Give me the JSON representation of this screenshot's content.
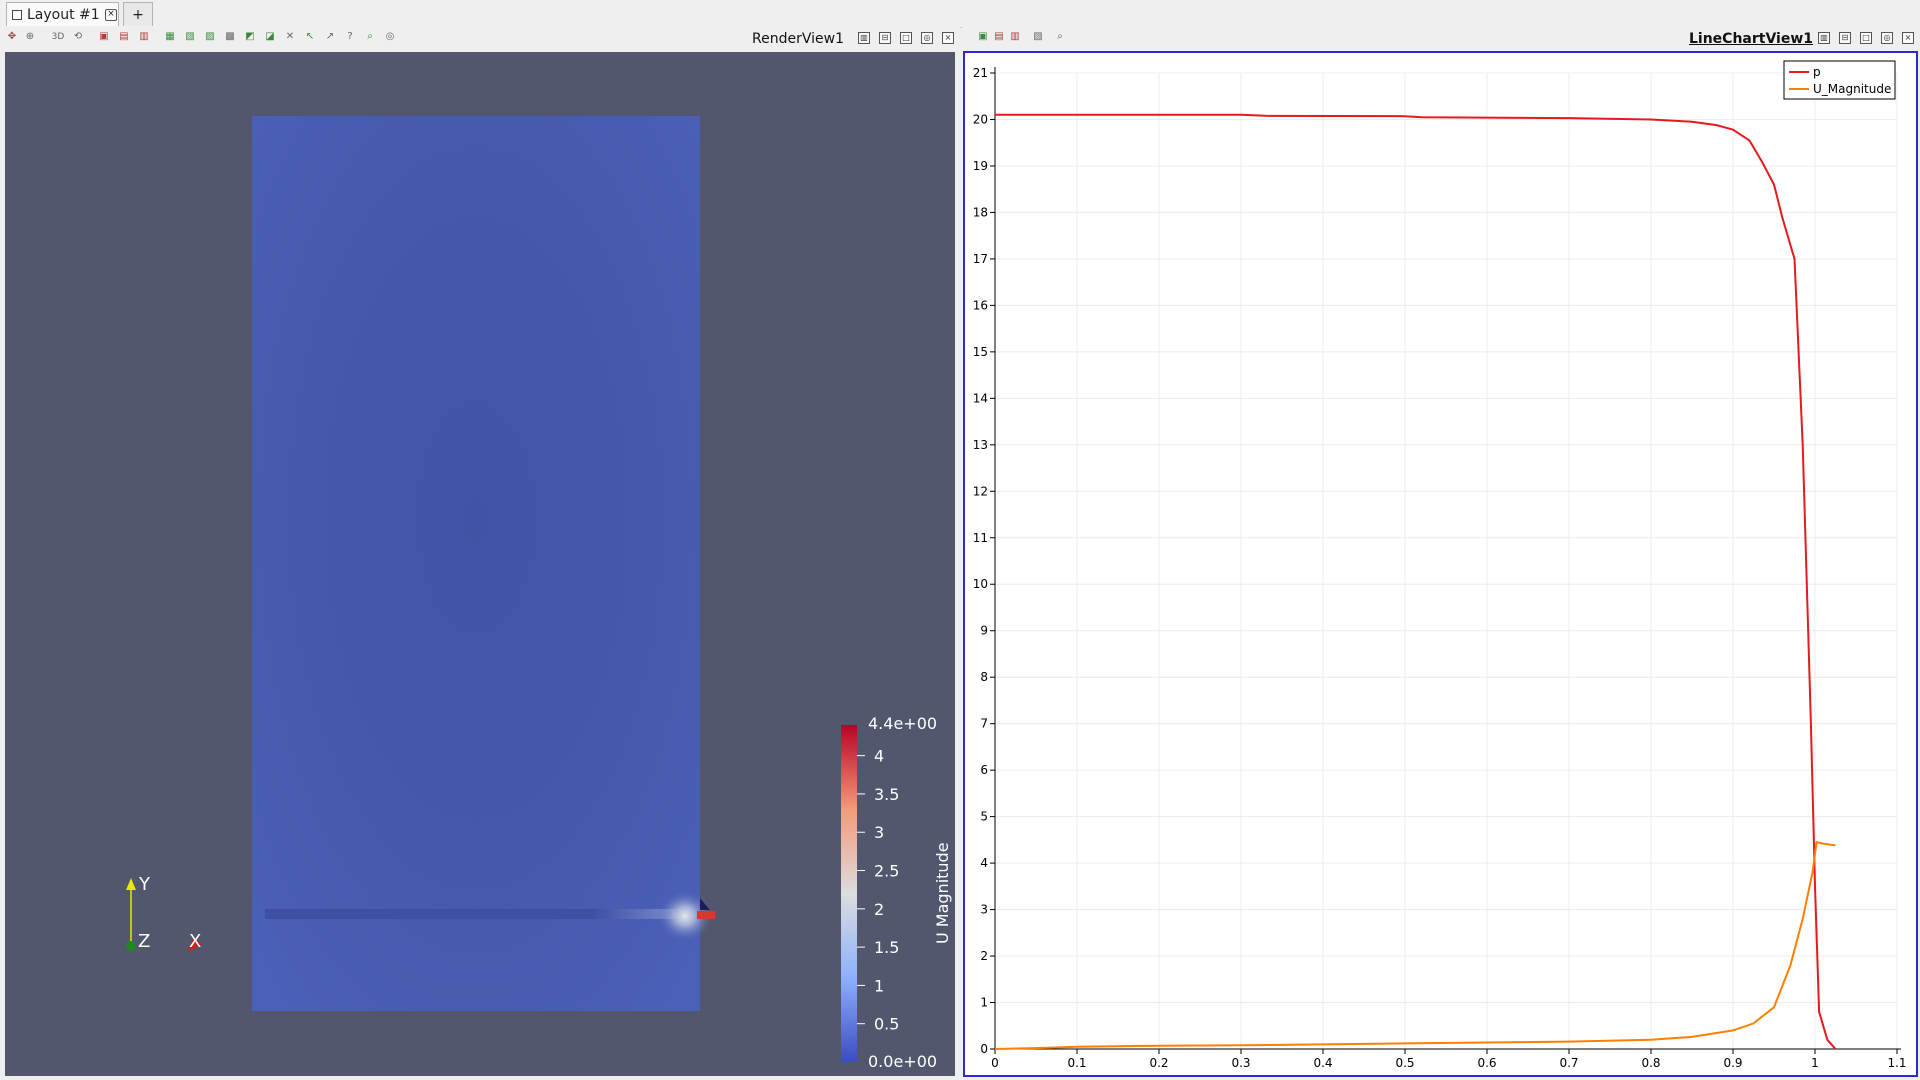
{
  "tabs": {
    "active_label": "Layout #1",
    "add_label": "+"
  },
  "render_view": {
    "title": "RenderView1",
    "toolbar_icons": [
      "reset-camera-icon",
      "zoom-closest-icon",
      "toggle-3d-icon",
      "camera-undo-icon",
      "camera-redo-icon",
      "select-cells-icon",
      "select-points-icon",
      "select-frustum-icon",
      "select-block-icon",
      "interactive-select-icon",
      "grow-selection-icon",
      "shrink-selection-icon",
      "clear-selection-icon",
      "hover-icon",
      "query-icon",
      "find-data-icon"
    ],
    "toggle_3d_label": "3D",
    "colorbar": {
      "title": "U Magnitude",
      "min_label": "0.0e+00",
      "max_label": "4.4e+00",
      "min": 0.0,
      "max": 4.4,
      "tick_values": [
        0.5,
        1,
        1.5,
        2,
        2.5,
        3,
        3.5,
        4
      ],
      "tick_labels": [
        "0.5",
        "1",
        "1.5",
        "2",
        "2.5",
        "3",
        "3.5",
        "4"
      ],
      "colors": [
        "#3b4cc0",
        "#dddddd",
        "#b40426"
      ]
    },
    "axes": {
      "y": "Y",
      "z": "Z",
      "x": "X"
    },
    "background": "#52576e",
    "domain_color": "#4559b0"
  },
  "chart_view": {
    "title": "LineChartView1",
    "view_buttons": [
      "split-horizontal-icon",
      "split-vertical-icon",
      "maximize-icon",
      "capture-icon",
      "close-icon"
    ]
  },
  "chart_data": {
    "type": "line",
    "xlim": [
      0,
      1.1
    ],
    "ylim": [
      0,
      21
    ],
    "x_ticks": [
      "0",
      "0.1",
      "0.2",
      "0.3",
      "0.4",
      "0.5",
      "0.6",
      "0.7",
      "0.8",
      "0.9",
      "1",
      "1.1"
    ],
    "y_ticks": [
      "0",
      "1",
      "2",
      "3",
      "4",
      "5",
      "6",
      "7",
      "8",
      "9",
      "10",
      "11",
      "12",
      "13",
      "14",
      "15",
      "16",
      "17",
      "18",
      "19",
      "20",
      "21"
    ],
    "grid": true,
    "legend_position": "top-right",
    "series": [
      {
        "name": "p",
        "color": "#e41a1c",
        "points": [
          [
            0,
            20.1
          ],
          [
            0.1,
            20.1
          ],
          [
            0.2,
            20.1
          ],
          [
            0.3,
            20.1
          ],
          [
            0.33,
            20.08
          ],
          [
            0.5,
            20.07
          ],
          [
            0.52,
            20.05
          ],
          [
            0.7,
            20.03
          ],
          [
            0.8,
            20.0
          ],
          [
            0.85,
            19.95
          ],
          [
            0.88,
            19.88
          ],
          [
            0.9,
            19.78
          ],
          [
            0.92,
            19.55
          ],
          [
            0.935,
            19.1
          ],
          [
            0.95,
            18.6
          ],
          [
            0.96,
            17.9
          ],
          [
            0.975,
            17.0
          ],
          [
            0.985,
            13.0
          ],
          [
            0.995,
            7.0
          ],
          [
            1.0,
            3.5
          ],
          [
            1.005,
            0.8
          ],
          [
            1.015,
            0.2
          ],
          [
            1.025,
            0.0
          ]
        ]
      },
      {
        "name": "U_Magnitude",
        "color": "#ff7f00",
        "points": [
          [
            0,
            0
          ],
          [
            0.05,
            0.02
          ],
          [
            0.1,
            0.05
          ],
          [
            0.2,
            0.07
          ],
          [
            0.3,
            0.08
          ],
          [
            0.4,
            0.1
          ],
          [
            0.5,
            0.12
          ],
          [
            0.6,
            0.14
          ],
          [
            0.7,
            0.16
          ],
          [
            0.8,
            0.2
          ],
          [
            0.85,
            0.26
          ],
          [
            0.9,
            0.4
          ],
          [
            0.925,
            0.55
          ],
          [
            0.95,
            0.9
          ],
          [
            0.97,
            1.8
          ],
          [
            0.985,
            2.8
          ],
          [
            0.997,
            3.8
          ],
          [
            1.002,
            4.45
          ],
          [
            1.01,
            4.42
          ],
          [
            1.025,
            4.38
          ]
        ]
      }
    ]
  }
}
